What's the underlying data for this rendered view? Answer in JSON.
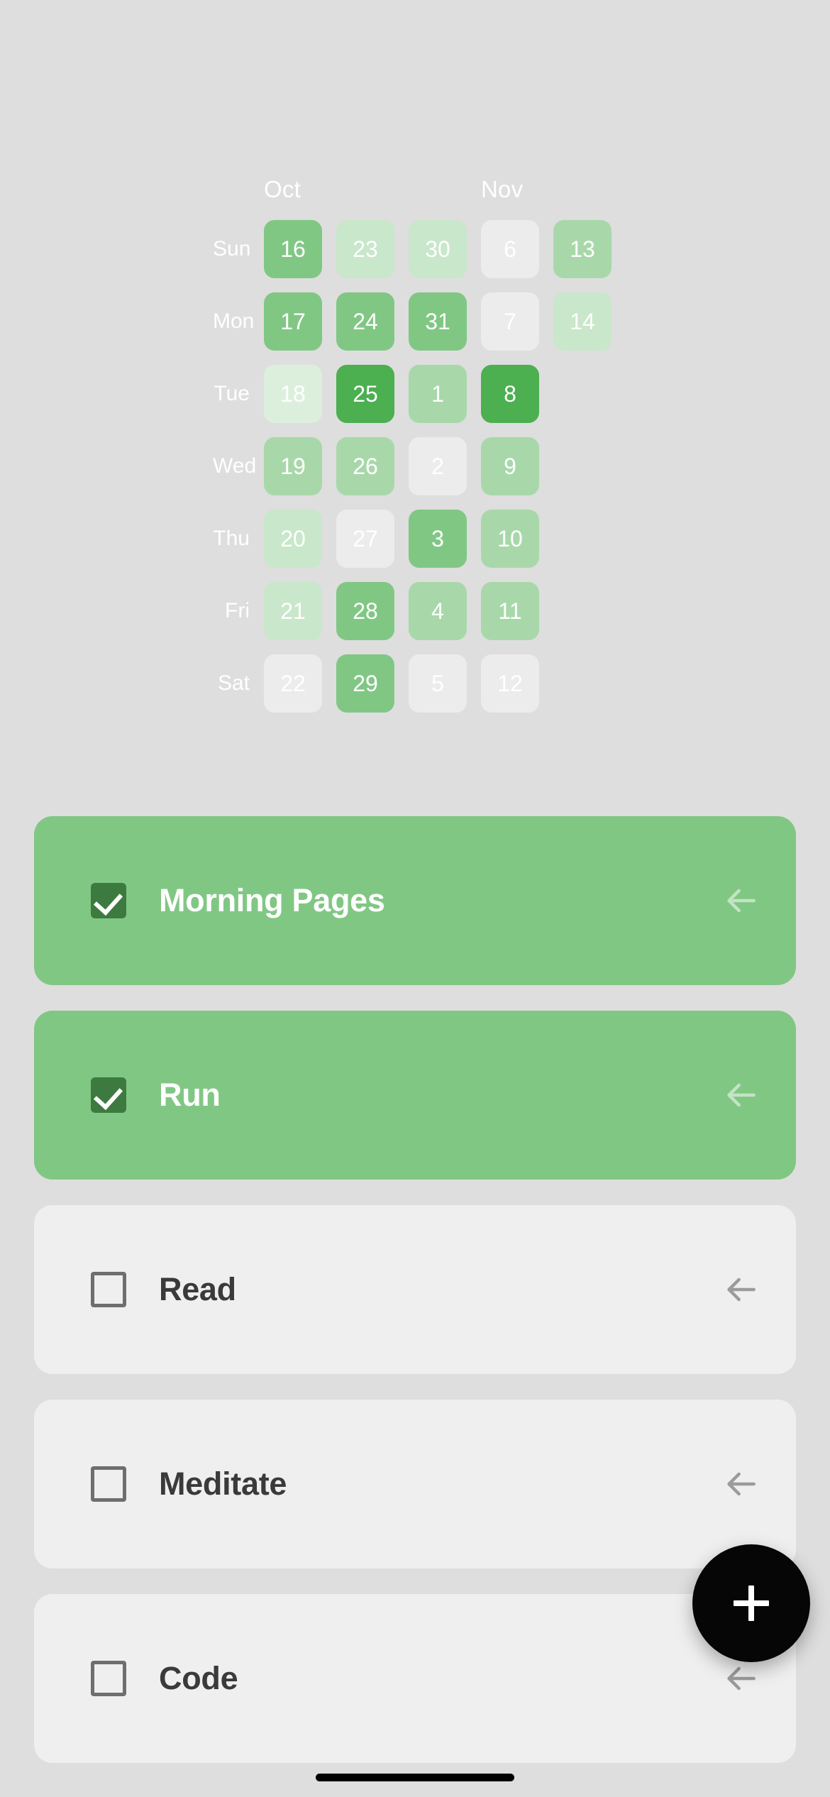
{
  "background_color": "#dedede",
  "heatmap": {
    "months": [
      {
        "label": "Oct",
        "column": 0
      },
      {
        "label": "Nov",
        "column": 3
      }
    ],
    "day_labels": [
      "Sun",
      "Mon",
      "Tue",
      "Wed",
      "Thu",
      "Fri",
      "Sat"
    ],
    "legend_colors": {
      "level0_empty": "#ececec",
      "level1": "#dcefdc",
      "level2": "#c9e7ca",
      "level3": "#a8d8aa",
      "level4": "#81c784",
      "level5": "#4caf50"
    },
    "rows": [
      {
        "day": "Sun",
        "cells": [
          {
            "date": "16",
            "level": 4
          },
          {
            "date": "23",
            "level": 2
          },
          {
            "date": "30",
            "level": 2
          },
          {
            "date": "6",
            "level": 0
          },
          {
            "date": "13",
            "level": 3
          }
        ]
      },
      {
        "day": "Mon",
        "cells": [
          {
            "date": "17",
            "level": 4
          },
          {
            "date": "24",
            "level": 4
          },
          {
            "date": "31",
            "level": 4
          },
          {
            "date": "7",
            "level": 0
          },
          {
            "date": "14",
            "level": 2
          }
        ]
      },
      {
        "day": "Tue",
        "cells": [
          {
            "date": "18",
            "level": 1
          },
          {
            "date": "25",
            "level": 5
          },
          {
            "date": "1",
            "level": 3
          },
          {
            "date": "8",
            "level": 5
          },
          {
            "date": "",
            "level": -1
          }
        ]
      },
      {
        "day": "Wed",
        "cells": [
          {
            "date": "19",
            "level": 3
          },
          {
            "date": "26",
            "level": 3
          },
          {
            "date": "2",
            "level": 0
          },
          {
            "date": "9",
            "level": 3
          },
          {
            "date": "",
            "level": -1
          }
        ]
      },
      {
        "day": "Thu",
        "cells": [
          {
            "date": "20",
            "level": 2
          },
          {
            "date": "27",
            "level": 0
          },
          {
            "date": "3",
            "level": 4
          },
          {
            "date": "10",
            "level": 3
          },
          {
            "date": "",
            "level": -1
          }
        ]
      },
      {
        "day": "Fri",
        "cells": [
          {
            "date": "21",
            "level": 2
          },
          {
            "date": "28",
            "level": 4
          },
          {
            "date": "4",
            "level": 3
          },
          {
            "date": "11",
            "level": 3
          },
          {
            "date": "",
            "level": -1
          }
        ]
      },
      {
        "day": "Sat",
        "cells": [
          {
            "date": "22",
            "level": 0
          },
          {
            "date": "29",
            "level": 4
          },
          {
            "date": "5",
            "level": 0
          },
          {
            "date": "12",
            "level": 0
          },
          {
            "date": "",
            "level": -1
          }
        ]
      }
    ]
  },
  "habits": [
    {
      "name": "Morning Pages",
      "completed": true,
      "checkbox_icon": "checkbox-checked-icon",
      "nav_icon": "arrow-left-icon"
    },
    {
      "name": "Run",
      "completed": true,
      "checkbox_icon": "checkbox-checked-icon",
      "nav_icon": "arrow-left-icon"
    },
    {
      "name": "Read",
      "completed": false,
      "checkbox_icon": "checkbox-empty-icon",
      "nav_icon": "arrow-left-icon"
    },
    {
      "name": "Meditate",
      "completed": false,
      "checkbox_icon": "checkbox-empty-icon",
      "nav_icon": "arrow-left-icon"
    },
    {
      "name": "Code",
      "completed": false,
      "checkbox_icon": "checkbox-empty-icon",
      "nav_icon": "arrow-left-icon"
    }
  ],
  "fab": {
    "icon": "plus-icon",
    "label": "+",
    "color": "#060606"
  },
  "system": {
    "home_indicator": "home-indicator"
  }
}
